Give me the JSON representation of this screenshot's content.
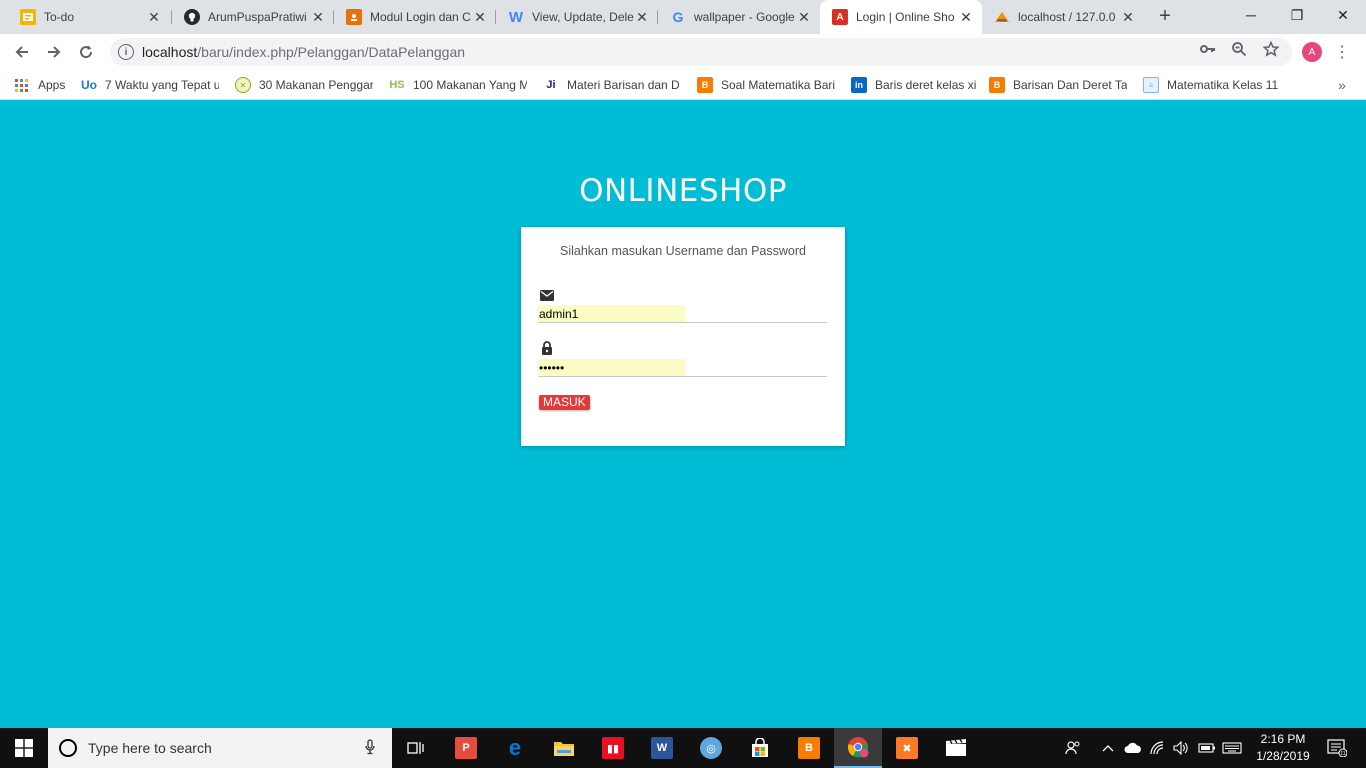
{
  "browser": {
    "tabs": [
      {
        "title": "To-do",
        "icon": "todo-icon",
        "color": "#f4b400"
      },
      {
        "title": "ArumPuspaPratiwi",
        "icon": "github-icon",
        "color": "#24292e"
      },
      {
        "title": "Modul Login dan C",
        "icon": "slides-icon",
        "color": "#e8710a"
      },
      {
        "title": "View, Update, Dele",
        "icon": "word-w-icon",
        "color": "#4285f4"
      },
      {
        "title": "wallpaper - Google",
        "icon": "google-icon",
        "color": "#4285f4"
      },
      {
        "title": "Login | Online Sho",
        "icon": "app-a-icon",
        "color": "#d93025",
        "active": true
      },
      {
        "title": "localhost / 127.0.0",
        "icon": "phpmyadmin-icon",
        "color": "#f29111"
      }
    ],
    "new_tab": "+",
    "window_controls": {
      "minimize": "─",
      "restore": "❐",
      "close": "✕"
    },
    "url": {
      "host": "localhost",
      "path": "/baru/index.php/Pelanggan/DataPelanggan"
    },
    "profile_initial": "A",
    "bookmarks": [
      {
        "label": "Apps",
        "icon": "apps-grid-icon"
      },
      {
        "label": "7 Waktu yang Tepat u",
        "icon": "uo-icon",
        "color": "#1c76d2"
      },
      {
        "label": "30 Makanan Penggar",
        "icon": "food-icon",
        "color": "#9e9d24"
      },
      {
        "label": "100 Makanan Yang M",
        "icon": "hs-icon",
        "color": "#8bc34a"
      },
      {
        "label": "Materi Barisan dan D",
        "icon": "ji-icon",
        "color": "#1a237e"
      },
      {
        "label": "Soal Matematika Bari",
        "icon": "blogger-icon",
        "color": "#f57d00"
      },
      {
        "label": "Baris deret kelas xi",
        "icon": "linkedin-icon",
        "color": "#0a66c2"
      },
      {
        "label": "Barisan Dan Deret Tak",
        "icon": "blogger-icon",
        "color": "#f57d00"
      },
      {
        "label": "Matematika Kelas 11",
        "icon": "doc-icon",
        "color": "#7cb5ec"
      }
    ],
    "bookmarks_more": "»"
  },
  "page": {
    "brand": "ONLINESHOP",
    "message": "Silahkan masukan Username dan Password",
    "username_value": "admin1",
    "password_value": "••••••",
    "submit_label": "MASUK",
    "bg_color": "#00bcd4",
    "button_color": "#e53935"
  },
  "taskbar": {
    "search_placeholder": "Type here to search",
    "apps": [
      {
        "icon": "task-view-icon"
      },
      {
        "icon": "paint-icon",
        "color": "#e74c3c"
      },
      {
        "icon": "edge-icon",
        "color": "#0078d7"
      },
      {
        "icon": "file-explorer-icon",
        "color": "#f8c03c"
      },
      {
        "icon": "reader-icon",
        "color": "#e81123"
      },
      {
        "icon": "word-icon",
        "color": "#2b579a"
      },
      {
        "icon": "globe-app-icon",
        "color": "#5fa8dd"
      },
      {
        "icon": "store-icon",
        "color": "#ffffff"
      },
      {
        "icon": "blogger-app-icon",
        "color": "#f57d00"
      },
      {
        "icon": "chrome-icon",
        "color": "#db4437",
        "active": true
      },
      {
        "icon": "xampp-icon",
        "color": "#fb7a24"
      },
      {
        "icon": "video-editor-icon",
        "color": "#ffffff"
      }
    ],
    "time": "2:16 PM",
    "date": "1/28/2019",
    "notification_count": "11"
  }
}
